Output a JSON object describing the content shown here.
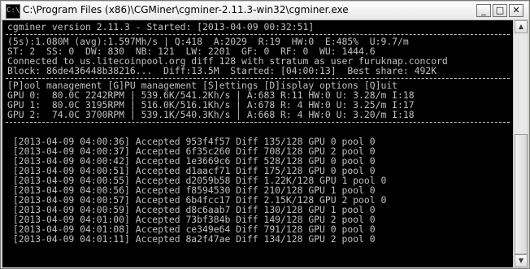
{
  "window": {
    "title": "C:\\Program Files (x86)\\CGMiner\\cgminer-2.11.3-win32\\cgminer.exe",
    "icon": "console-icon",
    "minimize_label": "_",
    "maximize_label": "□",
    "close_label": "✕"
  },
  "console": {
    "header": "cgminer version 2.11.3 - Started: [2013-04-09 00:32:51]",
    "status": [
      "(5s):1.080M (avg):1.597Mh/s | Q:418  A:2029  R:19  HW:0  E:485%  U:9.7/m",
      "ST: 2  SS: 0  DW: 830  NB: 121  LW: 2201  GF: 0  RF: 0  WU: 1444.6",
      "Connected to us.litecoinpool.org diff 128 with stratum as user furuknap.concord",
      "Block: 86de436448b38216...  Diff:13.5M  Started: [04:00:13]  Best share: 492K"
    ],
    "menu": "[P]ool management [G]PU management [S]ettings [D]isplay options [Q]uit",
    "gpus": [
      "GPU 0:  80.0C 2242RPM | 539.6K/541.2Kh/s | A:683 R:11 HW:0 U: 3.28/m I:18",
      "GPU 1:  80.0C 3195RPM | 516.0K/516.1Kh/s | A:678 R: 4 HW:0 U: 3.25/m I:17",
      "GPU 2:  74.0C 3700RPM | 539.1K/540.3Kh/s | A:668 R: 4 HW:0 U: 3.20/m I:18"
    ],
    "log": [
      " [2013-04-09 04:00:36] Accepted 953f4f57 Diff 135/128 GPU 0 pool 0",
      " [2013-04-09 04:00:37] Accepted 6f35c260 Diff 708/128 GPU 2 pool 0",
      " [2013-04-09 04:00:42] Accepted 1e3669c6 Diff 528/128 GPU 0 pool 0",
      " [2013-04-09 04:00:51] Accepted d1aacf71 Diff 175/128 GPU 0 pool 0",
      " [2013-04-09 04:00:55] Accepted d2059b58 Diff 1.22K/128 GPU 1 pool 0",
      " [2013-04-09 04:00:56] Accepted f8594530 Diff 210/128 GPU 1 pool 0",
      " [2013-04-09 04:00:57] Accepted 6b4fcc17 Diff 2.15K/128 GPU 2 pool 0",
      " [2013-04-09 04:00:59] Accepted d8c6aab7 Diff 130/128 GPU 1 pool 0",
      " [2013-04-09 04:01:00] Accepted 73bf384b Diff 149/128 GPU 2 pool 0",
      " [2013-04-09 04:01:08] Accepted ce349e64 Diff 791/128 GPU 0 pool 0",
      " [2013-04-09 04:01:11] Accepted 8a2f47ae Diff 134/128 GPU 2 pool 0"
    ]
  },
  "scrollbar": {
    "up_label": "▲",
    "down_label": "▼"
  }
}
